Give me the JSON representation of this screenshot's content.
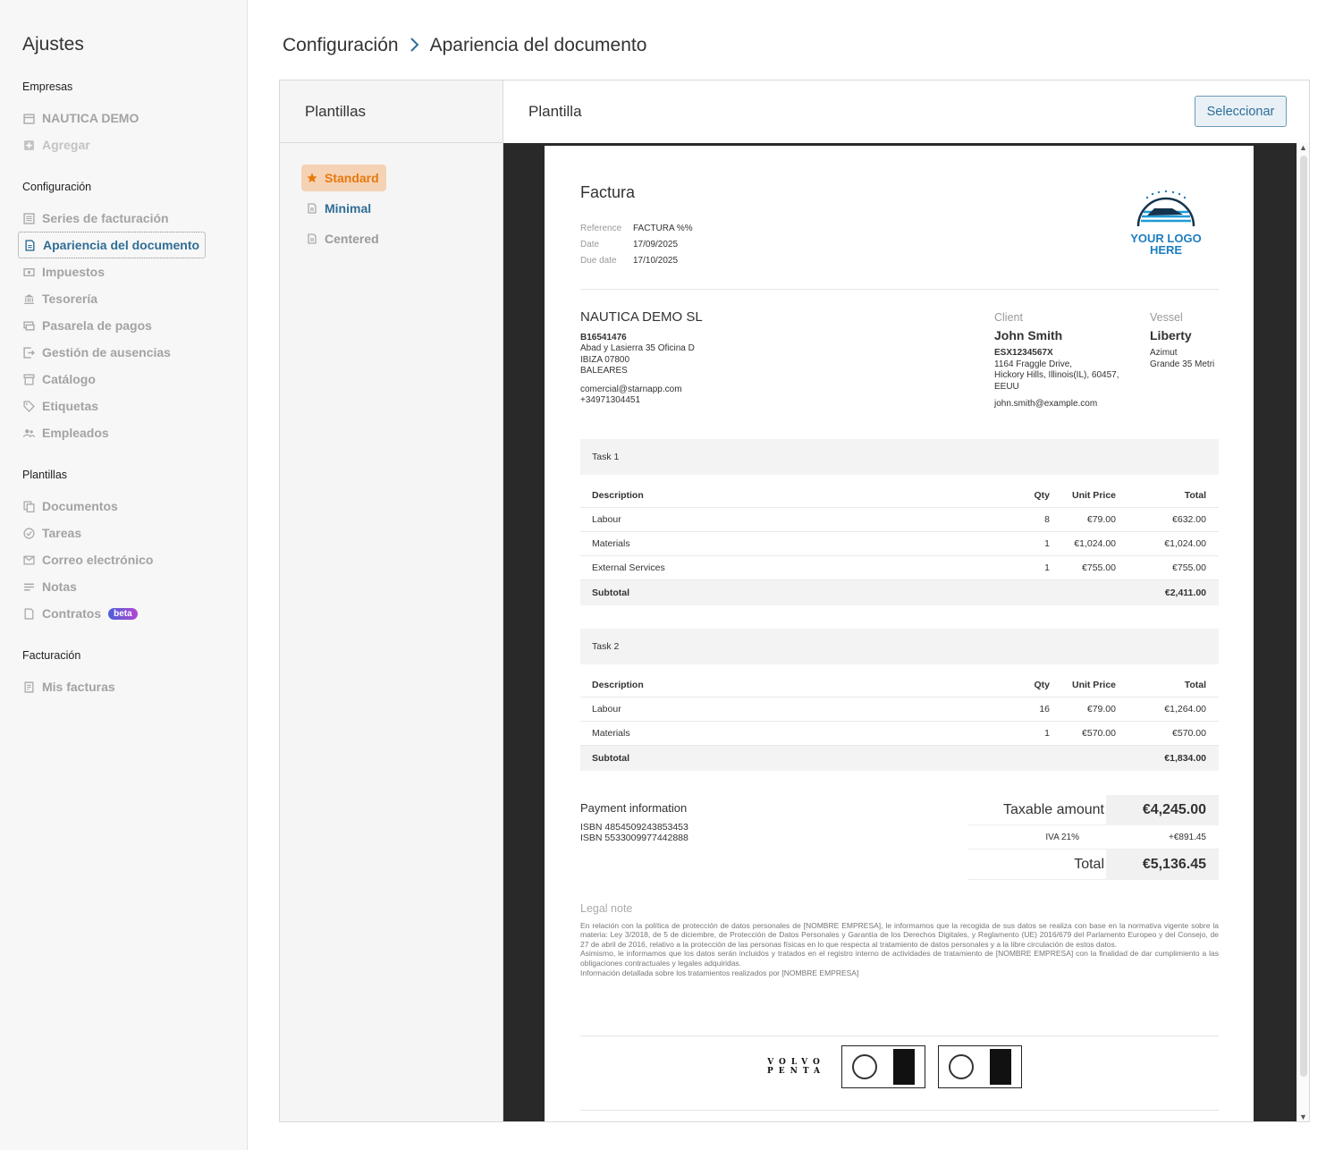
{
  "sidebar": {
    "title": "Ajustes",
    "groups": {
      "empresas": "Empresas",
      "configuracion": "Configuración",
      "plantillas": "Plantillas",
      "facturacion": "Facturación"
    },
    "items": {
      "nautica_demo": "NAUTICA DEMO",
      "agregar": "Agregar",
      "series": "Series de facturación",
      "apariencia": "Apariencia del documento",
      "impuestos": "Impuestos",
      "tesoreria": "Tesorería",
      "pasarela": "Pasarela de pagos",
      "ausencias": "Gestión de ausencias",
      "catalogo": "Catálogo",
      "etiquetas": "Etiquetas",
      "empleados": "Empleados",
      "documentos": "Documentos",
      "tareas": "Tareas",
      "correo": "Correo electrónico",
      "notas": "Notas",
      "contratos": "Contratos",
      "contratos_badge": "beta",
      "mis_facturas": "Mis facturas"
    }
  },
  "breadcrumb": {
    "parent": "Configuración",
    "current": "Apariencia del documento"
  },
  "panel": {
    "templates_title": "Plantillas",
    "template_title": "Plantilla",
    "select_button": "Seleccionar",
    "templates": [
      "Standard",
      "Minimal",
      "Centered"
    ]
  },
  "document": {
    "title": "Factura",
    "meta": {
      "reference_label": "Reference",
      "reference": "FACTURA %%",
      "date_label": "Date",
      "date": "17/09/2025",
      "due_label": "Due date",
      "due": "17/10/2025"
    },
    "logo": {
      "line1": "YOUR LOGO",
      "line2": "HERE"
    },
    "company": {
      "name": "NAUTICA DEMO SL",
      "tax_id": "B16541476",
      "address1": "Abad y Lasierra 35 Oficina D",
      "address2": "IBIZA 07800",
      "address3": "BALEARES",
      "email": "comercial@starnapp.com",
      "phone": "+34971304451"
    },
    "client": {
      "label": "Client",
      "name": "John Smith",
      "tax_id": "ESX1234567X",
      "address1": "1164 Fraggle Drive,",
      "address2": "Hickory Hills, Illinois(IL), 60457,",
      "address3": "EEUU",
      "email": "john.smith@example.com"
    },
    "vessel": {
      "label": "Vessel",
      "name": "Liberty",
      "line1": "Azimut",
      "line2": "Grande 35 Metri"
    },
    "columns": {
      "description": "Description",
      "qty": "Qty",
      "unit_price": "Unit Price",
      "total": "Total"
    },
    "subtotal_label": "Subtotal",
    "tasks": [
      {
        "name": "Task 1",
        "rows": [
          {
            "description": "Labour",
            "qty": "8",
            "unit_price": "€79.00",
            "total": "€632.00"
          },
          {
            "description": "Materials",
            "qty": "1",
            "unit_price": "€1,024.00",
            "total": "€1,024.00"
          },
          {
            "description": "External Services",
            "qty": "1",
            "unit_price": "€755.00",
            "total": "€755.00"
          }
        ],
        "subtotal": "€2,411.00"
      },
      {
        "name": "Task 2",
        "rows": [
          {
            "description": "Labour",
            "qty": "16",
            "unit_price": "€79.00",
            "total": "€1,264.00"
          },
          {
            "description": "Materials",
            "qty": "1",
            "unit_price": "€570.00",
            "total": "€570.00"
          }
        ],
        "subtotal": "€1,834.00"
      }
    ],
    "payment": {
      "title": "Payment information",
      "line1": "ISBN 4854509243853453",
      "line2": "ISBN 5533009977442888"
    },
    "totals": {
      "taxable_label": "Taxable amount",
      "taxable": "€4,245.00",
      "iva_label": "IVA 21%",
      "iva": "+€891.45",
      "total_label": "Total",
      "total": "€5,136.45"
    },
    "legal": {
      "title": "Legal note",
      "p1": "En relación con la política de protección de datos personales de [NOMBRE EMPRESA], le informamos que la recogida de sus datos se realiza con base en la normativa vigente sobre la materia: Ley 3/2018, de 5 de diciembre, de Protección de Datos Personales y Garantía de los Derechos Digitales, y Reglamento (UE) 2016/679 del Parlamento Europeo y del Consejo, de 27 de abril de 2016, relativo a la protección de las personas físicas en lo que respecta al tratamiento de datos personales y a la libre circulación de estos datos.",
      "p2": "Asimismo, le informamos que los datos serán incluidos y tratados en el registro interno de actividades de tratamiento de [NOMBRE EMPRESA] con la finalidad de dar cumplimiento a las obligaciones contractuales y legales adquiridas.",
      "p3": "Información detallada sobre los tratamientos realizados por [NOMBRE EMPRESA]"
    },
    "footer": {
      "volvo_line1": "VOLVO",
      "volvo_line2": "PENTA"
    }
  },
  "colors": {
    "accent": "#2f6e96",
    "standard_bg": "#f5d2b4",
    "standard_text": "#e8790c",
    "viewer_bg": "#292929"
  }
}
